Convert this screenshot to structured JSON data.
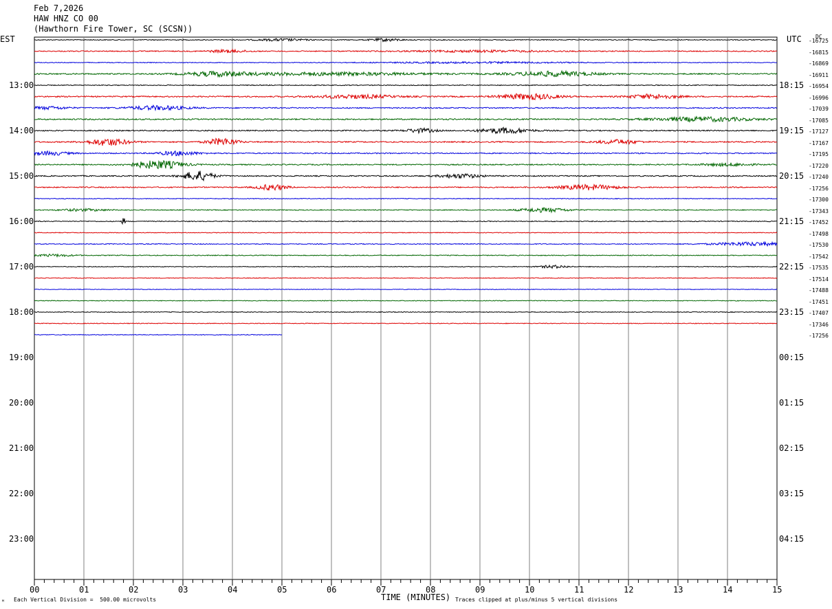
{
  "header": {
    "date": "Feb 7,2026",
    "station": "HAW HNZ CO 00",
    "location": "(Hawthorn Fire Tower, SC (SCSN))"
  },
  "left_zone": "EST",
  "right_zone": "UTC",
  "dc_label": "DC",
  "colors": {
    "cycle": [
      "#000000",
      "#dd0000",
      "#0000dd",
      "#006600"
    ],
    "grid": "#808080"
  },
  "footer": {
    "scale_note": "Each Vertical Division =  500.00 microvolts",
    "xlabel": "TIME (MINUTES)",
    "clip_note": "Traces clipped at plus/minus 5 vertical divisions",
    "corner_mark": "ᴹ"
  },
  "chart_data": {
    "type": "line",
    "title": "HAW HNZ CO 00",
    "xlabel": "TIME (MINUTES)",
    "xlim": [
      0,
      15
    ],
    "x_ticks": [
      "00",
      "01",
      "02",
      "03",
      "04",
      "05",
      "06",
      "07",
      "08",
      "09",
      "10",
      "11",
      "12",
      "13",
      "14",
      "15"
    ],
    "est_hours": [
      "13:00",
      "14:00",
      "15:00",
      "16:00",
      "17:00",
      "18:00",
      "19:00",
      "20:00",
      "21:00",
      "22:00",
      "23:00"
    ],
    "utc_hours": [
      "18:15",
      "19:15",
      "20:15",
      "21:15",
      "22:15",
      "23:15",
      "00:15",
      "01:15",
      "02:15",
      "03:15",
      "04:15"
    ],
    "rows_per_hour": 4,
    "traces": [
      {
        "dc": "-16725",
        "end_min": 15,
        "amp": 0.6,
        "events": [
          {
            "t": 5.0,
            "a": 1.5,
            "w": 0.5
          },
          {
            "t": 7.1,
            "a": 2,
            "w": 0.3
          }
        ]
      },
      {
        "dc": "-16815",
        "end_min": 15,
        "amp": 0.7,
        "events": [
          {
            "t": 3.9,
            "a": 2,
            "w": 0.4
          },
          {
            "t": 9.0,
            "a": 1.2,
            "w": 1.5
          }
        ]
      },
      {
        "dc": "-16869",
        "end_min": 15,
        "amp": 0.5,
        "events": [
          {
            "t": 9.0,
            "a": 1,
            "w": 2
          }
        ]
      },
      {
        "dc": "-16911",
        "end_min": 15,
        "amp": 0.9,
        "events": [
          {
            "t": 3.7,
            "a": 3,
            "w": 0.6
          },
          {
            "t": 6.0,
            "a": 2,
            "w": 2
          },
          {
            "t": 10.5,
            "a": 3.5,
            "w": 0.8
          }
        ]
      },
      {
        "dc": "-16954",
        "end_min": 15,
        "amp": 0.6,
        "events": []
      },
      {
        "dc": "-16996",
        "end_min": 15,
        "amp": 0.9,
        "events": [
          {
            "t": 6.5,
            "a": 2.5,
            "w": 0.8
          },
          {
            "t": 10.0,
            "a": 4,
            "w": 0.6
          },
          {
            "t": 12.5,
            "a": 3,
            "w": 0.5
          }
        ]
      },
      {
        "dc": "-17039",
        "end_min": 15,
        "amp": 0.8,
        "events": [
          {
            "t": 0.3,
            "a": 2,
            "w": 0.4
          },
          {
            "t": 2.5,
            "a": 3,
            "w": 0.6
          }
        ]
      },
      {
        "dc": "-17085",
        "end_min": 15,
        "amp": 0.9,
        "events": [
          {
            "t": 13.5,
            "a": 3,
            "w": 1
          }
        ]
      },
      {
        "dc": "-17127",
        "end_min": 15,
        "amp": 0.8,
        "events": [
          {
            "t": 7.8,
            "a": 3,
            "w": 0.3
          },
          {
            "t": 9.5,
            "a": 4,
            "w": 0.5
          }
        ]
      },
      {
        "dc": "-17167",
        "end_min": 15,
        "amp": 0.9,
        "events": [
          {
            "t": 1.5,
            "a": 5,
            "w": 0.4
          },
          {
            "t": 3.8,
            "a": 5,
            "w": 0.3
          },
          {
            "t": 11.8,
            "a": 3,
            "w": 0.4
          }
        ]
      },
      {
        "dc": "-17195",
        "end_min": 15,
        "amp": 0.8,
        "events": [
          {
            "t": 0.3,
            "a": 2.5,
            "w": 0.4
          },
          {
            "t": 2.9,
            "a": 3,
            "w": 0.4
          }
        ]
      },
      {
        "dc": "-17220",
        "end_min": 15,
        "amp": 0.8,
        "events": [
          {
            "t": 2.5,
            "a": 6,
            "w": 0.5
          },
          {
            "t": 14.0,
            "a": 2,
            "w": 0.5
          }
        ]
      },
      {
        "dc": "-17240",
        "end_min": 15,
        "amp": 0.8,
        "events": [
          {
            "t": 3.3,
            "a": 7,
            "w": 0.3
          },
          {
            "t": 8.6,
            "a": 3,
            "w": 0.4
          }
        ]
      },
      {
        "dc": "-17256",
        "end_min": 15,
        "amp": 0.8,
        "events": [
          {
            "t": 4.8,
            "a": 4,
            "w": 0.3
          },
          {
            "t": 11.2,
            "a": 3.5,
            "w": 0.6
          }
        ]
      },
      {
        "dc": "-17300",
        "end_min": 15,
        "amp": 0.5,
        "events": []
      },
      {
        "dc": "-17343",
        "end_min": 15,
        "amp": 0.6,
        "events": [
          {
            "t": 1.0,
            "a": 1.5,
            "w": 0.5
          },
          {
            "t": 10.3,
            "a": 3,
            "w": 0.5
          }
        ]
      },
      {
        "dc": "-17452",
        "end_min": 15,
        "amp": 0.6,
        "events": [
          {
            "t": 1.8,
            "a": 6,
            "w": 0.03
          }
        ]
      },
      {
        "dc": "-17498",
        "end_min": 15,
        "amp": 0.5,
        "events": []
      },
      {
        "dc": "-17530",
        "end_min": 15,
        "amp": 0.6,
        "events": [
          {
            "t": 14.5,
            "a": 2.5,
            "w": 0.8
          }
        ]
      },
      {
        "dc": "-17542",
        "end_min": 15,
        "amp": 0.6,
        "events": [
          {
            "t": 0.4,
            "a": 1.5,
            "w": 0.4
          }
        ]
      },
      {
        "dc": "-17535",
        "end_min": 15,
        "amp": 0.5,
        "events": [
          {
            "t": 10.5,
            "a": 2,
            "w": 0.3
          }
        ]
      },
      {
        "dc": "-17514",
        "end_min": 15,
        "amp": 0.5,
        "events": []
      },
      {
        "dc": "-17488",
        "end_min": 15,
        "amp": 0.4,
        "events": []
      },
      {
        "dc": "-17451",
        "end_min": 15,
        "amp": 0.5,
        "events": []
      },
      {
        "dc": "-17407",
        "end_min": 15,
        "amp": 0.5,
        "events": []
      },
      {
        "dc": "-17346",
        "end_min": 15,
        "amp": 0.5,
        "events": []
      },
      {
        "dc": "-17256",
        "end_min": 5,
        "amp": 0.5,
        "events": []
      }
    ]
  }
}
